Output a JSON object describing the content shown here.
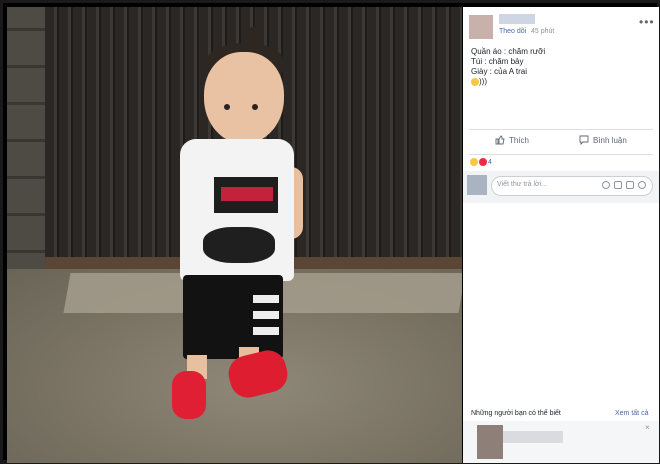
{
  "post": {
    "follow_label": "Theo dõi",
    "time_label": "45 phút",
    "more_label": "•••",
    "caption_lines": [
      "Quần áo : chăm rưỡi",
      "Túi : chăm bảy",
      "Giày : của A trai",
      ")))"
    ]
  },
  "actions": {
    "like_label": "Thích",
    "comment_label": "Bình luận",
    "like_icon": "thumbs-up-icon",
    "comment_icon": "speech-bubble-icon"
  },
  "reactions": {
    "count": "4",
    "types": [
      "haha-reaction-icon",
      "love-reaction-icon"
    ]
  },
  "comment_box": {
    "placeholder": "Viết thư trả lời...",
    "icons": [
      "emoji-icon",
      "camera-icon",
      "gif-icon",
      "sticker-icon"
    ]
  },
  "friends": {
    "title": "Những người bạn có thể biết",
    "see_all_label": "Xem tất cả",
    "close_label": "×"
  },
  "colors": {
    "link": "#4b67a1",
    "shoe_red": "#e01f34",
    "panel_bg": "#ffffff"
  }
}
